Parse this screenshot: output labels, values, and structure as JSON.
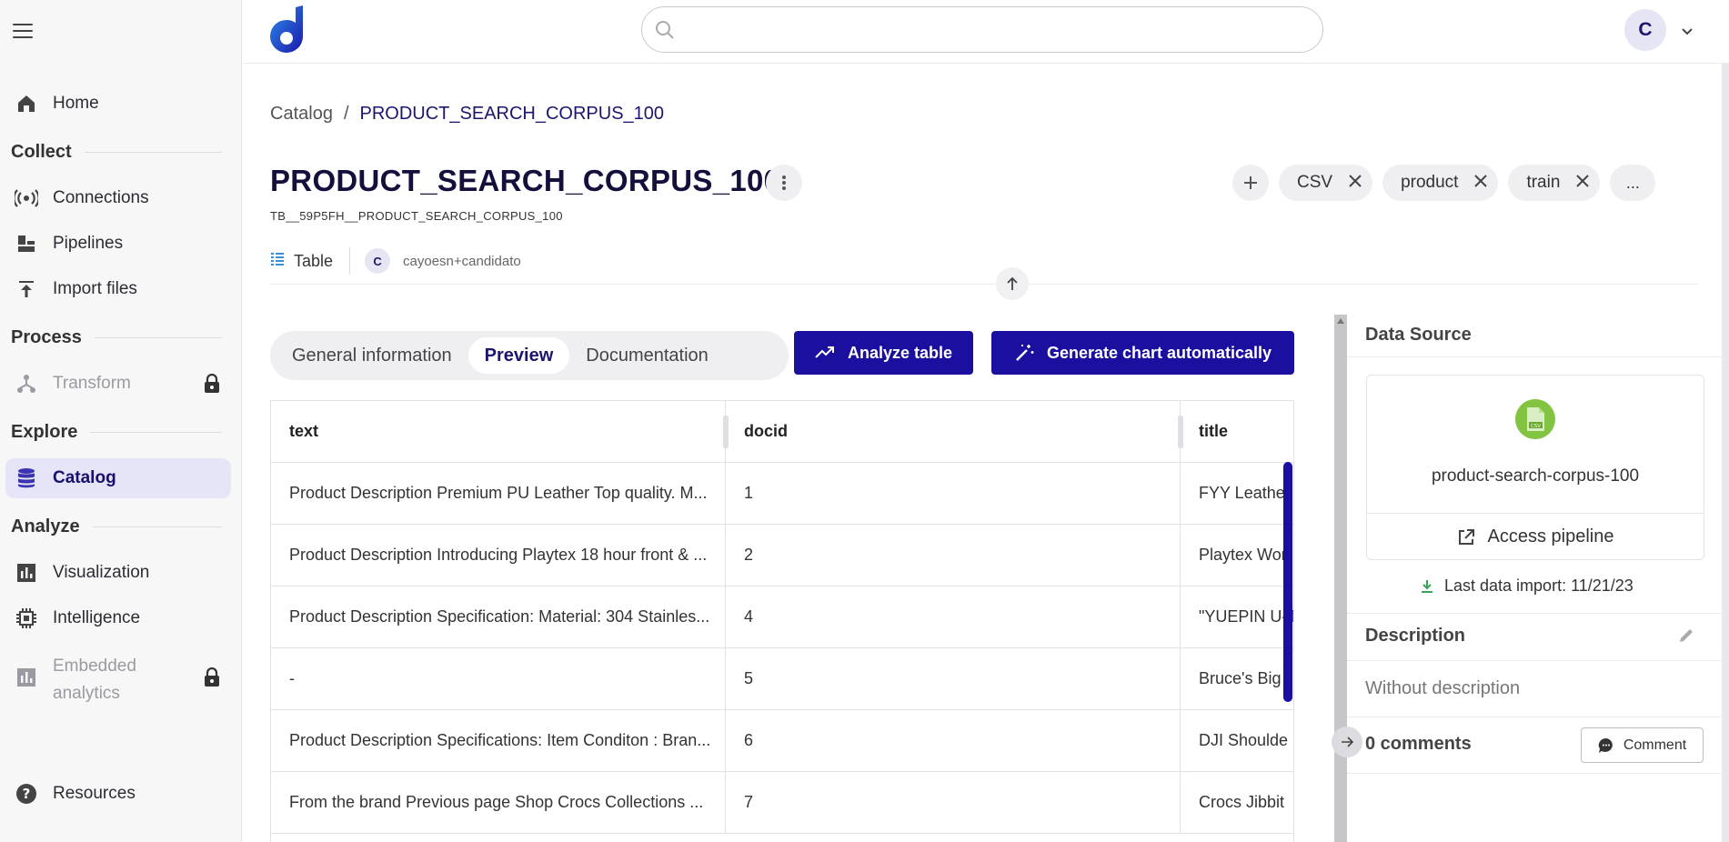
{
  "sidebar": {
    "home": "Home",
    "collect": "Collect",
    "connections": "Connections",
    "pipelines": "Pipelines",
    "import_files": "Import files",
    "process": "Process",
    "transform": "Transform",
    "explore": "Explore",
    "catalog": "Catalog",
    "analyze": "Analyze",
    "visualization": "Visualization",
    "intelligence": "Intelligence",
    "embedded_line1": "Embedded",
    "embedded_line2": "analytics",
    "resources": "Resources"
  },
  "topbar": {
    "search_placeholder": "",
    "avatar_initial": "C"
  },
  "breadcrumb": {
    "root": "Catalog",
    "separator": "/",
    "current": "PRODUCT_SEARCH_CORPUS_100"
  },
  "page": {
    "title": "PRODUCT_SEARCH_CORPUS_100",
    "table_id": "TB__59P5FH__PRODUCT_SEARCH_CORPUS_100",
    "type_label": "Table",
    "owner_initial": "C",
    "owner": "cayoesn+candidato",
    "tags": [
      "CSV",
      "product",
      "train"
    ],
    "more_tags": "..."
  },
  "tabs": [
    "General information",
    "Preview",
    "Documentation"
  ],
  "active_tab": "Preview",
  "buttons": {
    "analyze": "Analyze table",
    "generate_chart": "Generate chart automatically"
  },
  "table": {
    "columns": [
      "text",
      "docid",
      "title"
    ],
    "rows": [
      [
        "Product Description Premium PU Leather Top quality. M...",
        "1",
        "FYY Leather"
      ],
      [
        "Product Description Introducing Playtex 18 hour front & ...",
        "2",
        "Playtex Wor"
      ],
      [
        "Product Description Specification: Material: 304 Stainles...",
        "4",
        "\"YUEPIN U-T"
      ],
      [
        "-",
        "5",
        "Bruce's Big"
      ],
      [
        "Product Description Specifications: Item Conditon : Bran...",
        "6",
        "DJI Shoulde"
      ],
      [
        "From the brand Previous page Shop Crocs Collections ...",
        "7",
        "Crocs Jibbit"
      ]
    ]
  },
  "panel": {
    "data_source_title": "Data Source",
    "source_name": "product-search-corpus-100",
    "csv_badge": "CSV",
    "access_pipeline": "Access pipeline",
    "last_import": "Last data import: 11/21/23",
    "description_title": "Description",
    "description_text": "Without description",
    "comments_count": "0 comments",
    "comment_button": "Comment"
  },
  "colors": {
    "primary": "#1a0f9e",
    "csv_green": "#82c341",
    "active_nav_bg": "#e6e5f7"
  }
}
